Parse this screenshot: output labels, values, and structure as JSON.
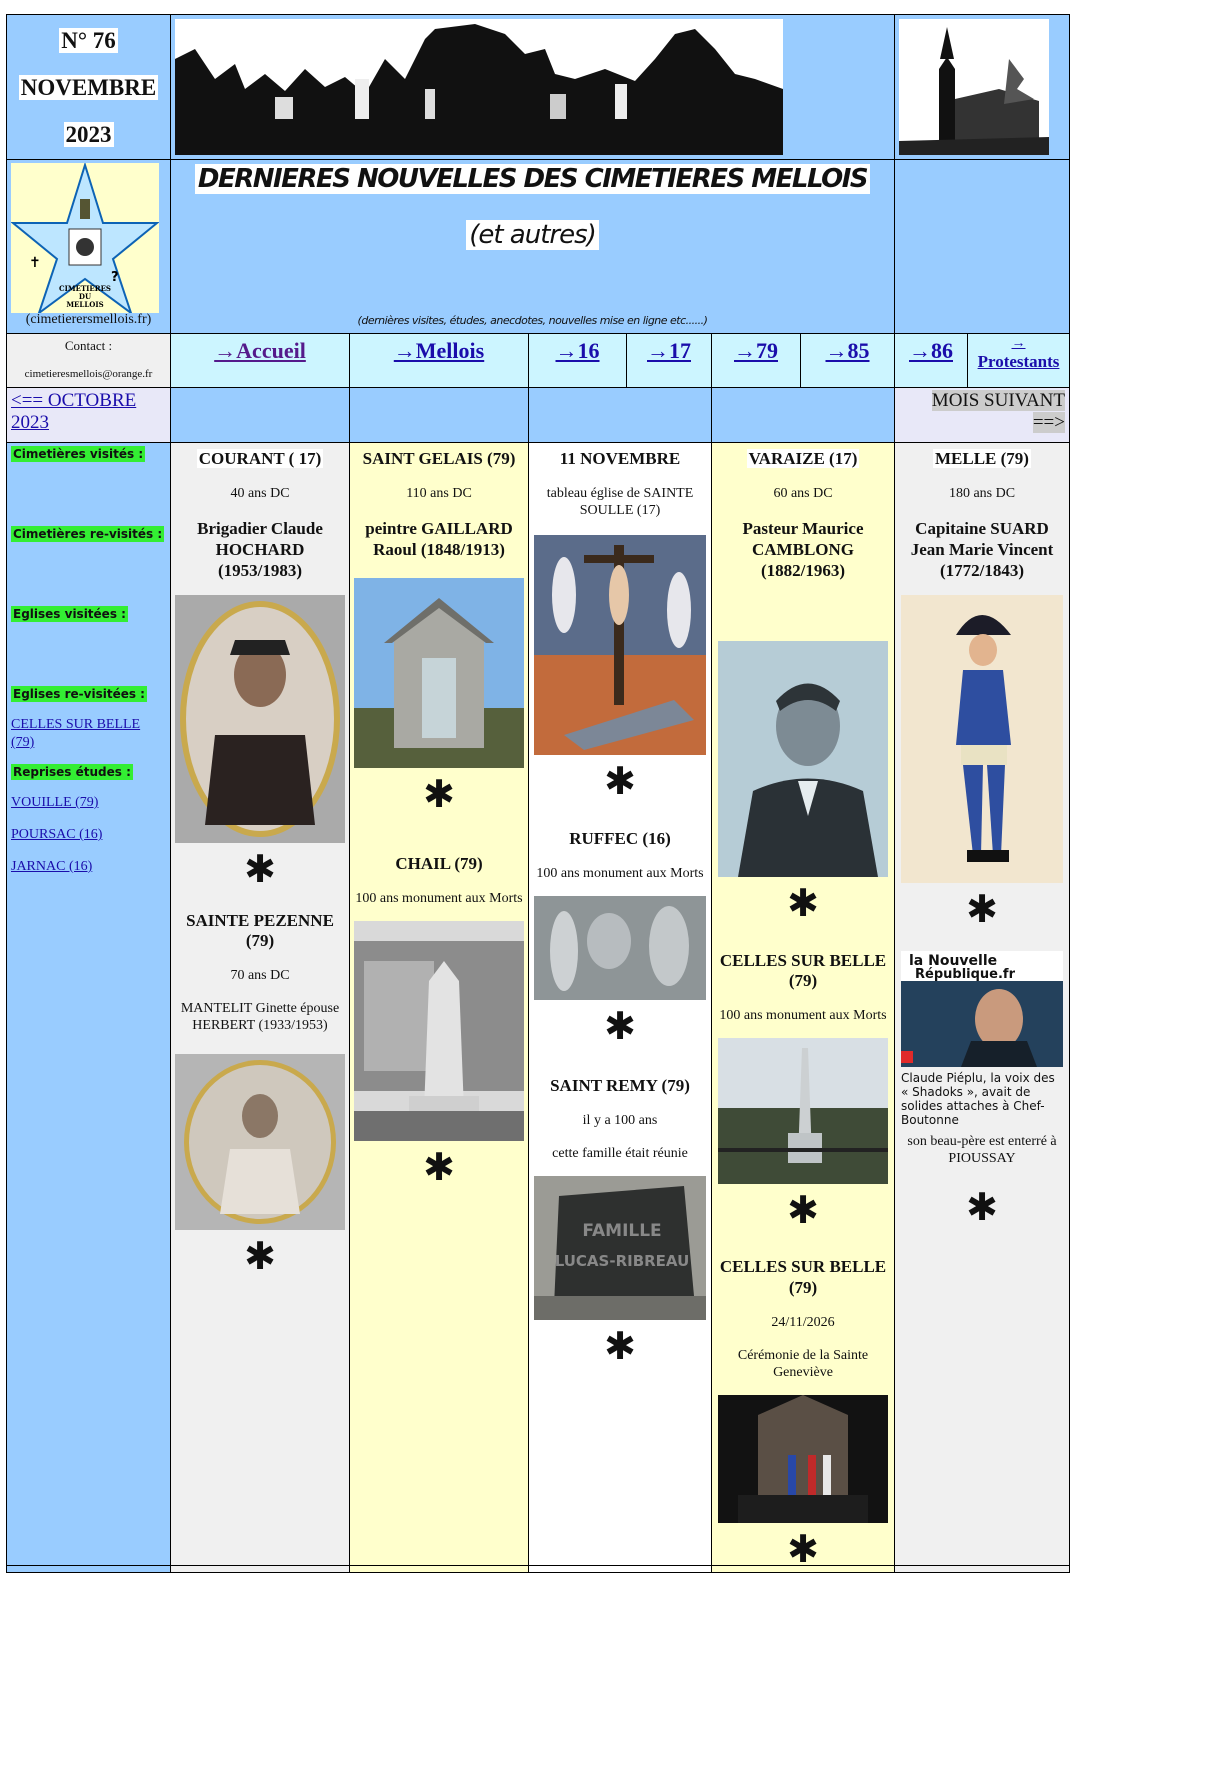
{
  "header": {
    "issue_number": "N° 76",
    "issue_month": "NOVEMBRE",
    "issue_year": "2023"
  },
  "title": {
    "main": "DERNIERES NOUVELLES DES CIMETIERES MELLOIS",
    "sub": "(et autres)",
    "note": "(dernières visites, études, anecdotes, nouvelles mise en ligne etc......)"
  },
  "logo": {
    "caption": "(cimetierersmellois.fr)",
    "text_line1": "CIMETIERES",
    "text_line2": "DU",
    "text_line3": "MELLOIS"
  },
  "contact": {
    "label": "Contact :",
    "email": "cimetieresmellois@orange.fr"
  },
  "nav": [
    {
      "label": "→Accueil"
    },
    {
      "label": "→Mellois"
    },
    {
      "label": "→16"
    },
    {
      "label": "→17"
    },
    {
      "label": "→79"
    },
    {
      "label": "→85"
    },
    {
      "label": "→86"
    },
    {
      "label_top": "→",
      "label_bottom": "Protestants"
    }
  ],
  "pager": {
    "prev": "<== OCTOBRE 2023",
    "next_line1": "MOIS SUIVANT",
    "next_line2": "==>"
  },
  "sidebar": {
    "visited_cemeteries": "Cimetières visités :",
    "revisited_cemeteries": "Cimetières re-visités :",
    "visited_churches": "Eglises visitées :",
    "revisited_churches": "Eglises re-visitées :",
    "revisited_church_link": "CELLES SUR BELLE (79)",
    "resumed_studies": "Reprises études :",
    "study_links": [
      "VOUILLE (79)",
      "POURSAC (16)",
      "JARNAC (16)"
    ]
  },
  "columns": {
    "col1": {
      "entry1": {
        "place": "COURANT ( 17)",
        "info": "40 ans DC",
        "name": "Brigadier Claude HOCHARD (1953/1983)"
      },
      "entry2": {
        "place": "SAINTE PEZENNE (79)",
        "info": "70 ans DC",
        "detail": "MANTELIT Ginette épouse HERBERT (1933/1953)"
      }
    },
    "col2": {
      "entry1": {
        "place": "SAINT GELAIS (79)",
        "info": "110 ans DC",
        "name": "peintre GAILLARD Raoul (1848/1913)"
      },
      "entry2": {
        "place": "CHAIL (79)",
        "info": "100 ans monument aux Morts"
      }
    },
    "col3": {
      "entry1": {
        "place": "11 NOVEMBRE",
        "info": "tableau église de SAINTE SOULLE (17)"
      },
      "entry2": {
        "place": "RUFFEC (16)",
        "info": "100 ans monument aux Morts"
      },
      "entry3": {
        "place": "SAINT REMY (79)",
        "info": "il y a 100 ans",
        "detail": "cette famille était réunie",
        "plaque_line1": "FAMILLE",
        "plaque_line2": "LUCAS-RIBREAU"
      }
    },
    "col4": {
      "entry1": {
        "place": "VARAIZE (17)",
        "info": "60 ans DC",
        "name": "Pasteur Maurice CAMBLONG (1882/1963)"
      },
      "entry2": {
        "place": "CELLES SUR BELLE (79)",
        "info": "100 ans monument aux Morts"
      },
      "entry3": {
        "place": "CELLES SUR BELLE (79)",
        "info": "24/11/2026",
        "detail": "Cérémonie de la Sainte Geneviève"
      }
    },
    "col5": {
      "entry1": {
        "place": "MELLE (79)",
        "info": "180 ans DC",
        "name": "Capitaine SUARD Jean Marie Vincent (1772/1843)"
      },
      "entry2": {
        "brand_line1": "la Nouvelle",
        "brand_line2": "République.fr",
        "article": "Claude Piéplu, la voix des « Shadoks », avait de solides attaches à Chef-Boutonne",
        "note": "son beau-père est enterré à PIOUSSAY"
      }
    }
  },
  "star": "✱"
}
